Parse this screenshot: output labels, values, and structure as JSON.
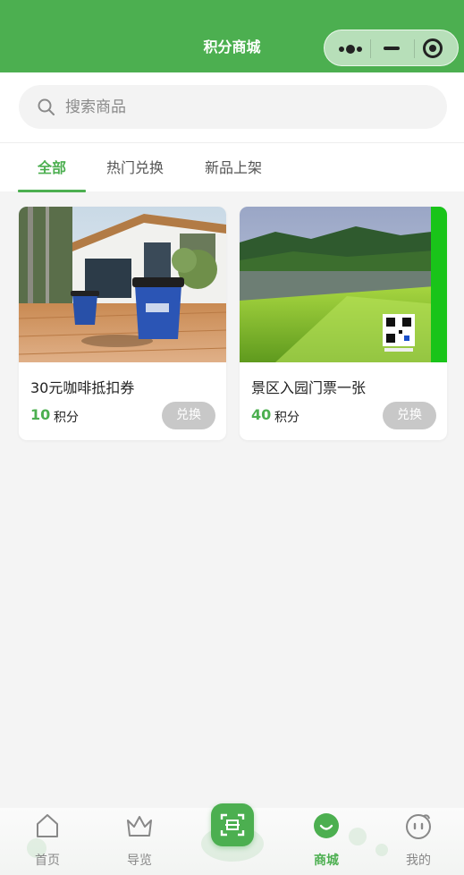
{
  "header": {
    "title": "积分商城",
    "background": "#4caf50"
  },
  "search": {
    "placeholder": "搜索商品",
    "value": ""
  },
  "tabs": [
    {
      "label": "全部",
      "active": true
    },
    {
      "label": "热门兑换",
      "active": false
    },
    {
      "label": "新品上架",
      "active": false
    }
  ],
  "products": [
    {
      "title": "30元咖啡抵扣券",
      "points": "10",
      "unit": "积分",
      "button": "兑换",
      "image": "coffee-cups-cafe-photo"
    },
    {
      "title": "景区入园门票一张",
      "points": "40",
      "unit": "积分",
      "button": "兑换",
      "image": "scenic-lake-grass-photo"
    }
  ],
  "bottom_nav": [
    {
      "label": "首页",
      "icon": "home-icon",
      "active": false
    },
    {
      "label": "导览",
      "icon": "crown-icon",
      "active": false
    },
    {
      "label": "",
      "icon": "scan-icon",
      "active": false
    },
    {
      "label": "商城",
      "icon": "smile-icon",
      "active": true
    },
    {
      "label": "我的",
      "icon": "face-icon",
      "active": false
    }
  ],
  "colors": {
    "accent": "#4caf50",
    "button_disabled": "#c8c8c8",
    "text": "#222222"
  }
}
